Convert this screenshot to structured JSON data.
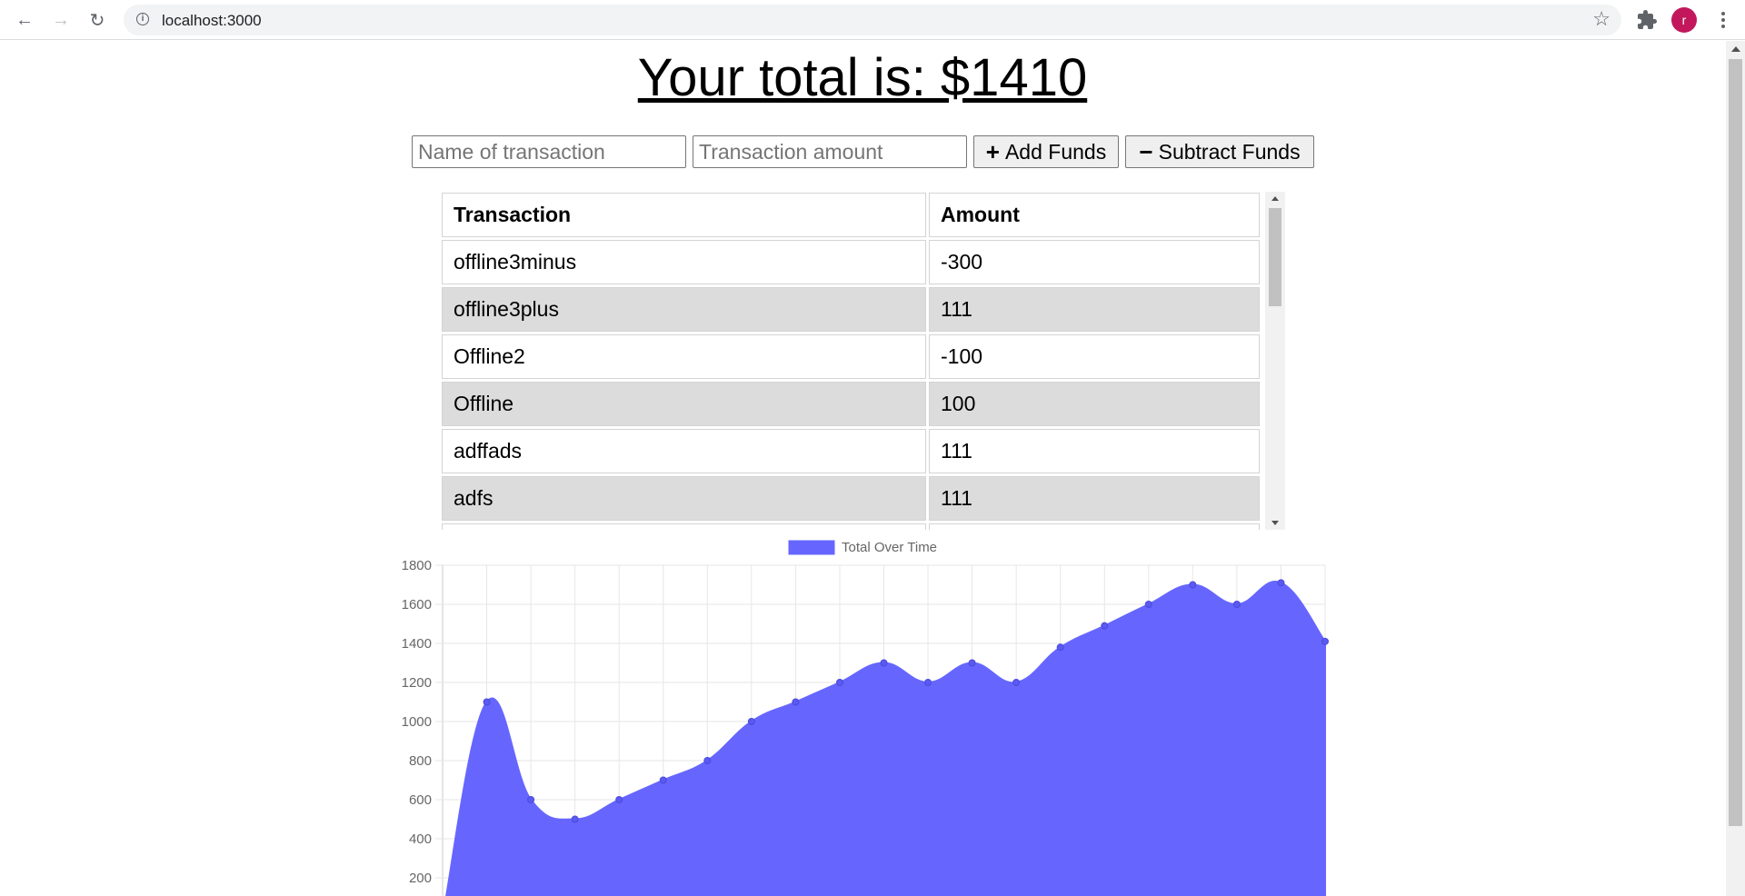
{
  "browser": {
    "url": "localhost:3000",
    "avatar_letter": "r"
  },
  "page": {
    "title": "Your total is: $1410"
  },
  "form": {
    "name_placeholder": "Name of transaction",
    "amount_placeholder": "Transaction amount",
    "add_label": "Add Funds",
    "add_symbol": "+",
    "subtract_label": "Subtract Funds",
    "subtract_symbol": "−"
  },
  "table": {
    "headers": [
      "Transaction",
      "Amount"
    ],
    "rows": [
      {
        "name": "offline3minus",
        "amount": "-300"
      },
      {
        "name": "offline3plus",
        "amount": "111"
      },
      {
        "name": "Offline2",
        "amount": "-100"
      },
      {
        "name": "Offline",
        "amount": "100"
      },
      {
        "name": "adffads",
        "amount": "111"
      },
      {
        "name": "adfs",
        "amount": "111"
      },
      {
        "name": "",
        "amount": ""
      }
    ]
  },
  "chart_data": {
    "type": "area",
    "legend": "Total Over Time",
    "legend_position": "top-center",
    "fill_color": "#6666ff",
    "grid": true,
    "ylim": [
      0,
      1800
    ],
    "yticks": [
      200,
      400,
      600,
      800,
      1000,
      1200,
      1400,
      1600,
      1800
    ],
    "series": [
      {
        "name": "Total Over Time",
        "values": [
          0,
          1100,
          600,
          500,
          600,
          700,
          800,
          1000,
          1100,
          1200,
          1300,
          1200,
          1300,
          1200,
          1380,
          1490,
          1600,
          1700,
          1600,
          1710,
          1410
        ]
      }
    ]
  }
}
